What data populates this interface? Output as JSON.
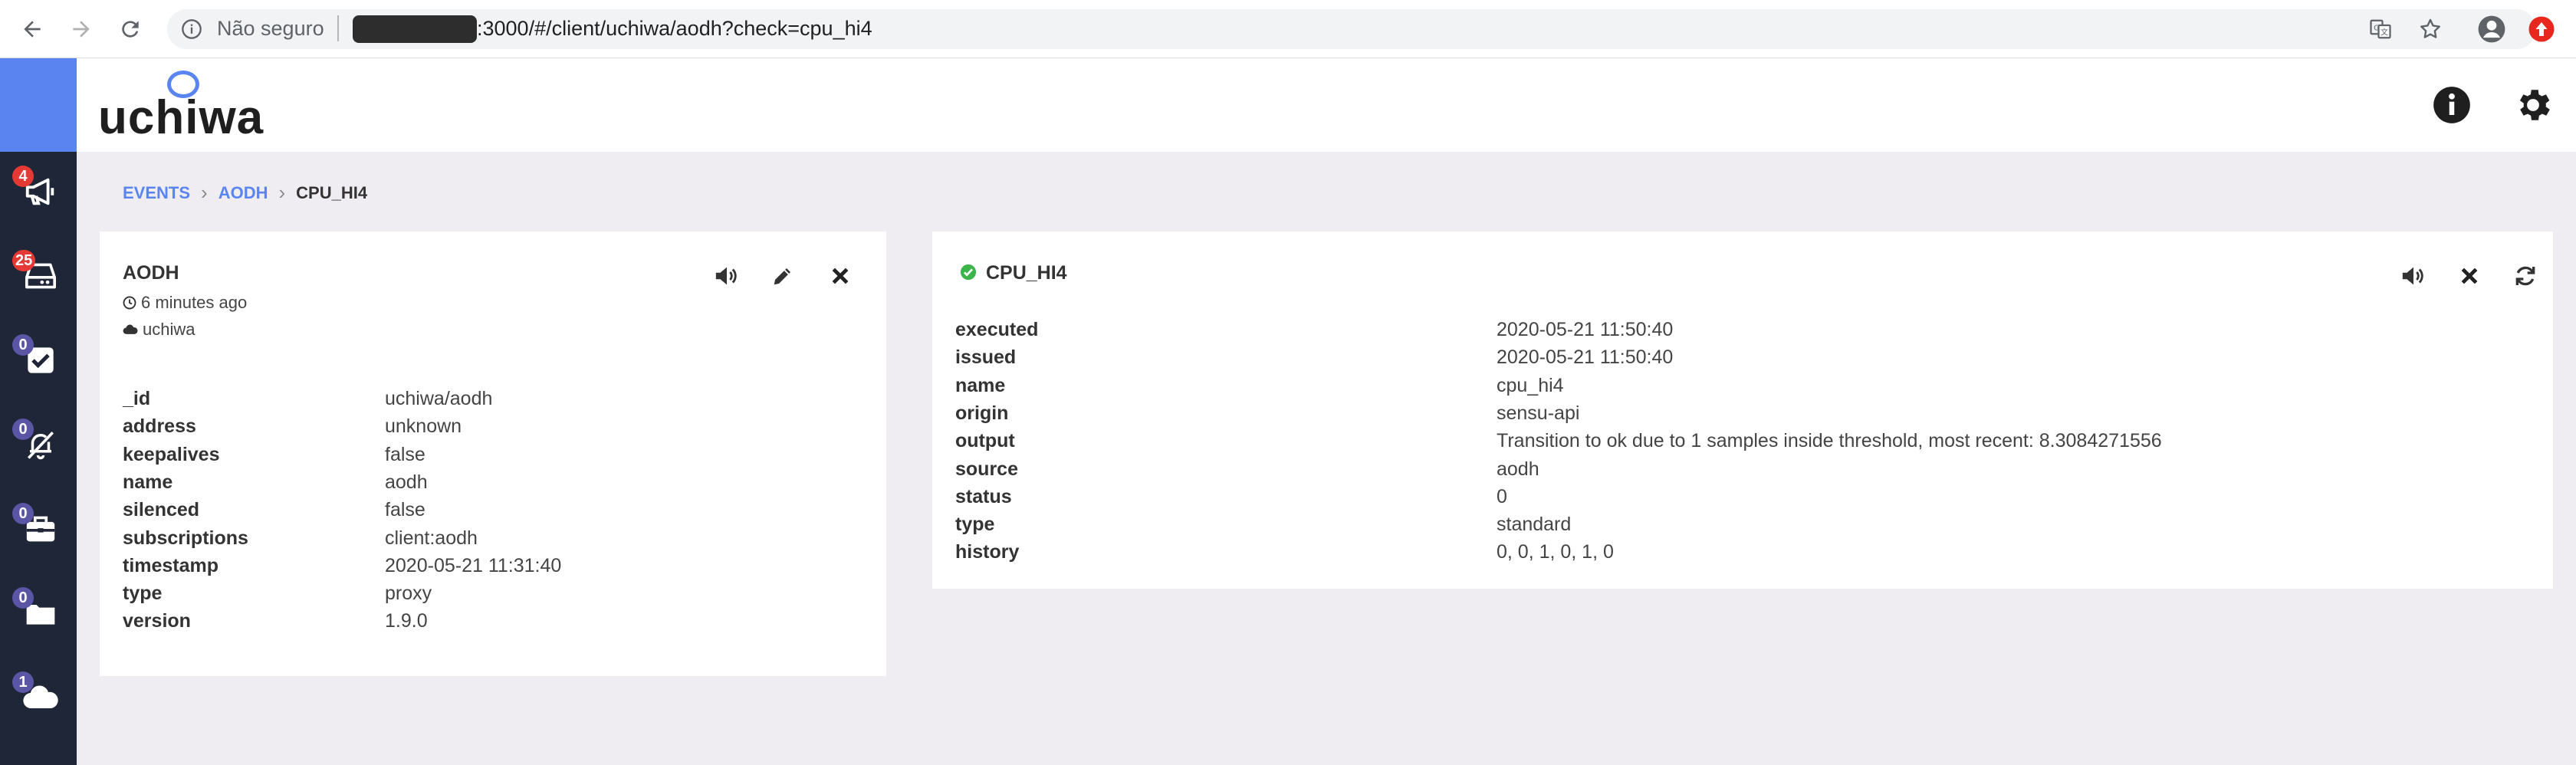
{
  "browser": {
    "insecure_label": "Não seguro",
    "url": ":3000/#/client/uchiwa/aodh?check=cpu_hi4"
  },
  "app": {
    "logo_text": "uchiwa"
  },
  "sidebar": {
    "items": [
      {
        "name": "events",
        "icon": "megaphone-icon",
        "badge": "4",
        "badge_color": "#e53935"
      },
      {
        "name": "clients",
        "icon": "server-icon",
        "badge": "25",
        "badge_color": "#e53935"
      },
      {
        "name": "checks",
        "icon": "checkbox-icon",
        "badge": "0",
        "badge_color": "#5b55a6"
      },
      {
        "name": "silenced",
        "icon": "muted-icon",
        "badge": "0",
        "badge_color": "#5b55a6"
      },
      {
        "name": "stashes",
        "icon": "briefcase-icon",
        "badge": "0",
        "badge_color": "#5b55a6"
      },
      {
        "name": "aggregates",
        "icon": "folder-icon",
        "badge": "0",
        "badge_color": "#5b55a6"
      },
      {
        "name": "datacenters",
        "icon": "cloud-icon",
        "badge": "1",
        "badge_color": "#5b55a6"
      }
    ]
  },
  "breadcrumb": {
    "events": "EVENTS",
    "client": "AODH",
    "check": "CPU_HI4"
  },
  "client_card": {
    "title": "AODH",
    "time_ago": "6 minutes ago",
    "datacenter": "uchiwa",
    "rows": [
      {
        "key": "_id",
        "value": "uchiwa/aodh"
      },
      {
        "key": "address",
        "value": "unknown"
      },
      {
        "key": "keepalives",
        "value": "false"
      },
      {
        "key": "name",
        "value": "aodh"
      },
      {
        "key": "silenced",
        "value": "false"
      },
      {
        "key": "subscriptions",
        "value": "client:aodh"
      },
      {
        "key": "timestamp",
        "value": "2020-05-21 11:31:40"
      },
      {
        "key": "type",
        "value": "proxy"
      },
      {
        "key": "version",
        "value": "1.9.0"
      }
    ]
  },
  "check_card": {
    "title": "CPU_HI4",
    "status_color": "#3bb54a",
    "rows": [
      {
        "key": "executed",
        "value": "2020-05-21 11:50:40"
      },
      {
        "key": "issued",
        "value": "2020-05-21 11:50:40"
      },
      {
        "key": "name",
        "value": "cpu_hi4"
      },
      {
        "key": "origin",
        "value": "sensu-api"
      },
      {
        "key": "output",
        "value": "Transition to ok due to 1 samples inside threshold, most recent: 8.3084271556"
      },
      {
        "key": "source",
        "value": "aodh"
      },
      {
        "key": "status",
        "value": "0"
      },
      {
        "key": "type",
        "value": "standard"
      },
      {
        "key": "history",
        "value": "0, 0, 1, 0, 1, 0"
      }
    ]
  }
}
